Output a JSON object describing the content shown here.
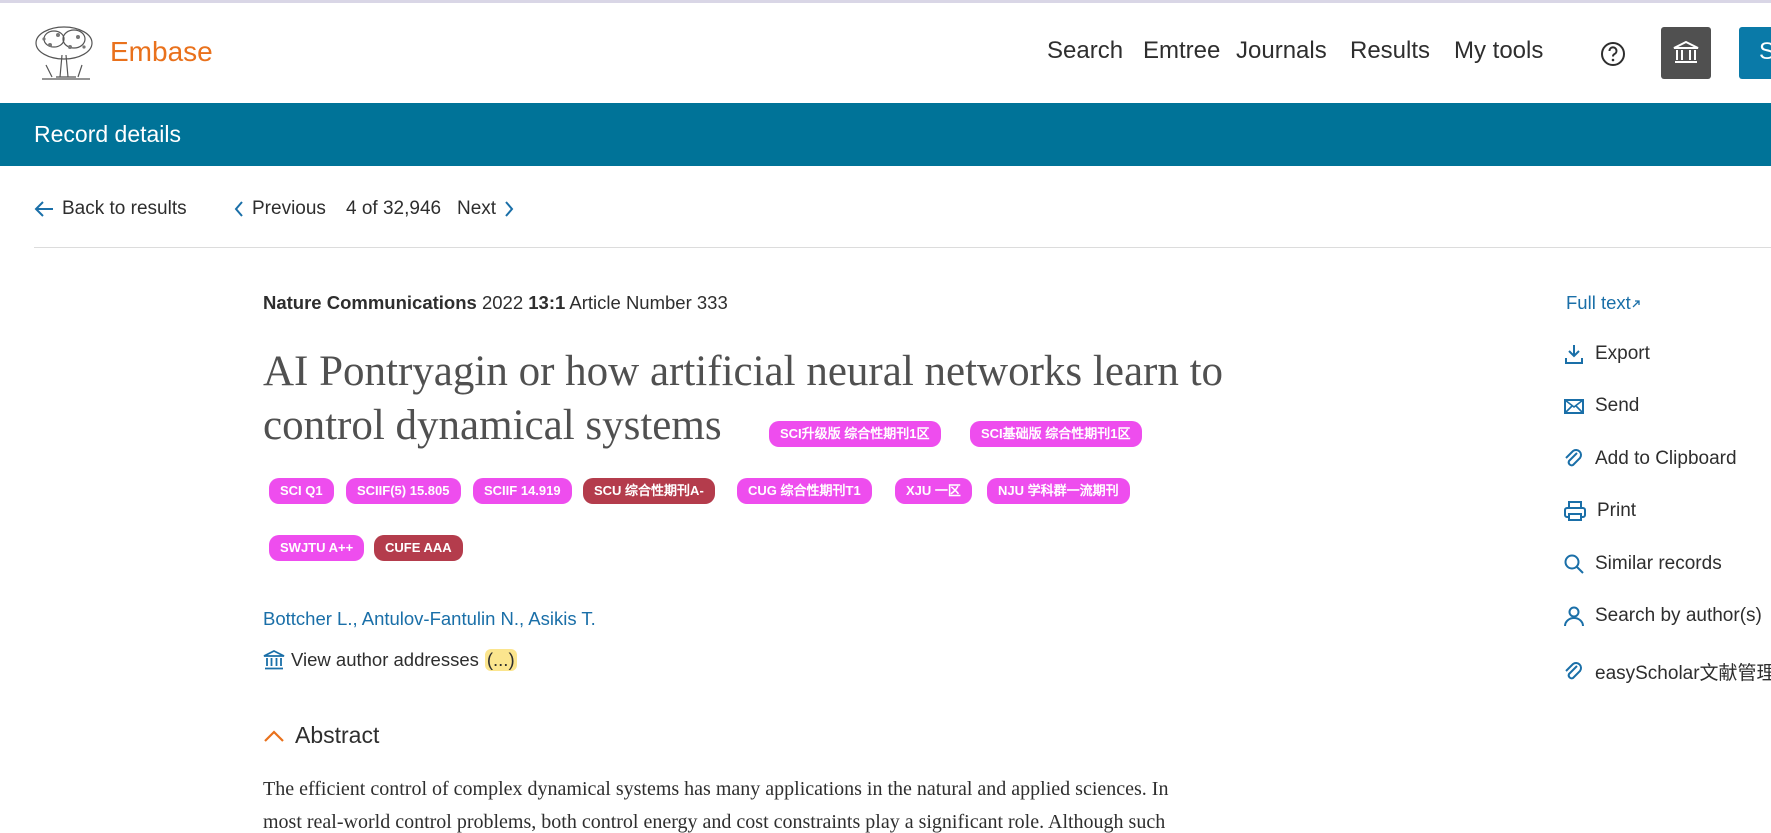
{
  "header": {
    "brand": "Embase",
    "nav": [
      "Search",
      "Emtree",
      "Journals",
      "Results",
      "My tools"
    ],
    "signin_label": "S"
  },
  "banner": {
    "title": "Record details"
  },
  "pager": {
    "back": "Back to results",
    "previous": "Previous",
    "position": "4 of 32,946",
    "next": "Next"
  },
  "record": {
    "journal": "Nature Communications",
    "year": "2022",
    "volume_issue": "13:1",
    "article": "Article Number 333",
    "title_line1": "AI Pontryagin or how artificial neural networks learn to",
    "title_line2": "control dynamical systems",
    "badges_inline": [
      "SCI升级版 综合性期刊1区",
      "SCI基础版 综合性期刊1区"
    ],
    "badges_row1": [
      "SCI Q1",
      "SCIIF(5) 15.805",
      "SCIIF 14.919",
      "SCU 综合性期刊A-",
      "CUG 综合性期刊T1",
      "XJU 一区",
      "NJU 学科群一流期刊"
    ],
    "badges_row2": [
      "SWJTU A++",
      "CUFE AAA"
    ],
    "authors": "Bottcher L., Antulov-Fantulin N., Asikis T.",
    "view_addresses": "View author addresses",
    "ellipsis": "(...)",
    "abstract_heading": "Abstract",
    "abstract_line1": "The efficient control of complex dynamical systems has many applications in the natural and applied sciences. In",
    "abstract_line2": "most real-world control problems, both control energy and cost constraints play a significant role. Although such"
  },
  "sidebar": {
    "full_text": "Full text",
    "actions": [
      "Export",
      "Send",
      "Add to Clipboard",
      "Print",
      "Similar records",
      "Search by author(s)",
      "easyScholar文献管理"
    ]
  },
  "colors": {
    "brand": "#e9711c",
    "banner": "#007398",
    "link": "#1a6fa8",
    "badge_pink": "#ee4dee",
    "badge_red": "#b43c4c"
  }
}
